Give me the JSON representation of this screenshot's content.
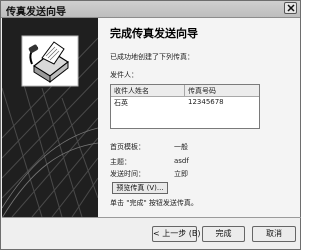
{
  "window": {
    "title": "传真发送向导"
  },
  "page": {
    "heading": "完成传真发送向导",
    "created_text": "已成功地创建了下列传真：",
    "sender_label": "发件人：",
    "list": {
      "columns": [
        "收件人姓名",
        "传真号码"
      ],
      "rows": [
        {
          "name": "石英",
          "number": "12345678"
        }
      ]
    },
    "cover_label": "首页模板：",
    "cover_value": "一般",
    "subject_label": "主题：",
    "subject_value": "asdf",
    "send_time_label": "发送时间：",
    "send_time_value": "立即",
    "preview_button": "预览传真 (V)...",
    "finish_hint": "单击 \"完成\" 按钮发送传真。"
  },
  "buttons": {
    "back": "< 上一步 (B)",
    "finish": "完成",
    "cancel": "取消"
  },
  "icons": {
    "close": "close-icon",
    "sidebar": "fax-machine-icon"
  }
}
